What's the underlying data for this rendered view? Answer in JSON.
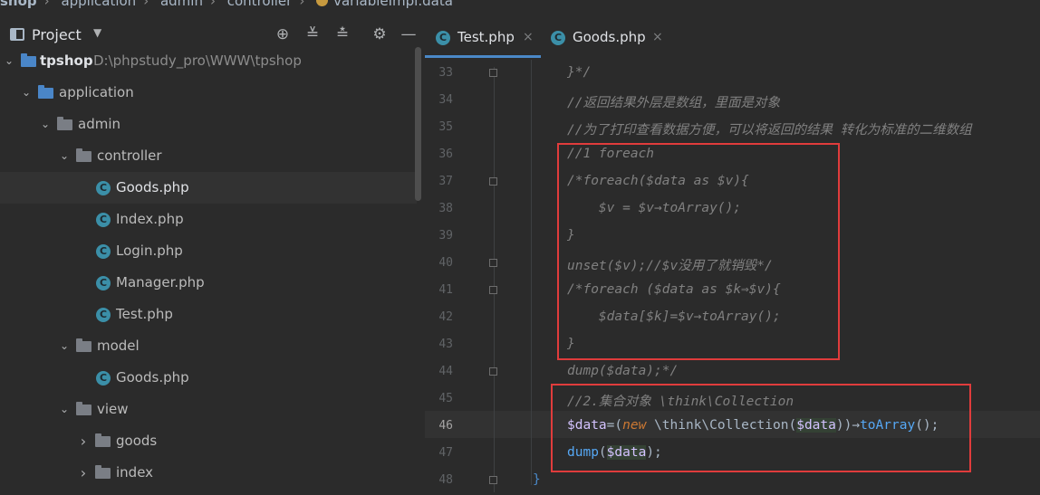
{
  "breadcrumb": [
    "shop",
    "application",
    "admin",
    "controller",
    "variableImpl.data"
  ],
  "panel": {
    "title": "Project",
    "caret": "▼",
    "tools": [
      "⊕",
      "≚",
      "≛",
      "⚙",
      "—"
    ]
  },
  "tree": [
    {
      "label": "tpshop",
      "path": "D:\\phpstudy_pro\\WWW\\tpshop",
      "arrow": "⌄",
      "kind": "folder-blue"
    },
    {
      "label": "application",
      "arrow": "⌄",
      "kind": "folder-blue"
    },
    {
      "label": "admin",
      "arrow": "⌄",
      "kind": "folder"
    },
    {
      "label": "controller",
      "arrow": "⌄",
      "kind": "folder"
    },
    {
      "label": "Goods.php",
      "kind": "class",
      "selected": true
    },
    {
      "label": "Index.php",
      "kind": "class"
    },
    {
      "label": "Login.php",
      "kind": "class"
    },
    {
      "label": "Manager.php",
      "kind": "class"
    },
    {
      "label": "Test.php",
      "kind": "class"
    },
    {
      "label": "model",
      "arrow": "⌄",
      "kind": "folder"
    },
    {
      "label": "Goods.php",
      "kind": "class"
    },
    {
      "label": "view",
      "arrow": "⌄",
      "kind": "folder"
    },
    {
      "label": "goods",
      "arrow": "›",
      "kind": "folder"
    },
    {
      "label": "index",
      "arrow": "›",
      "kind": "folder"
    }
  ],
  "tabs": [
    {
      "label": "Test.php",
      "icon": "C",
      "close": "×",
      "active": true
    },
    {
      "label": "Goods.php",
      "icon": "C",
      "close": "×",
      "active": false
    }
  ],
  "line_numbers": [
    "33",
    "34",
    "35",
    "36",
    "37",
    "38",
    "39",
    "40",
    "41",
    "42",
    "43",
    "44",
    "45",
    "46",
    "47",
    "48"
  ],
  "code": {
    "l33": "}*/",
    "l34": "//返回结果外层是数组，里面是对象",
    "l35": "//为了打印查看数据方便，可以将返回的结果 转化为标准的二维数组",
    "l36": "//1 foreach",
    "l37": "/*foreach($data as $v){",
    "l38": "    $v = $v→toArray();",
    "l39": "}",
    "l40": "unset($v);//$v没用了就销毁*/",
    "l41": "/*foreach ($data as $k⇒$v){",
    "l42": "    $data[$k]=$v→toArray();",
    "l43": "}",
    "l44": "dump($data);*/",
    "l45": "//2.集合对象 \\think\\Collection",
    "l46": {
      "v1": "$data",
      "eq": "=(",
      "kw": "new",
      "ns": " \\think\\",
      "cls": "Collection",
      "p1": "(",
      "v2": "$data",
      "p2": "))→",
      "fn": "toArray",
      "end": "();"
    },
    "l47": {
      "fn": "dump",
      "p1": "(",
      "v": "$data",
      "end": ");"
    },
    "l48": "}"
  },
  "colors": {
    "highlight_box": "#e03c3c",
    "accent": "#4a88c7"
  }
}
